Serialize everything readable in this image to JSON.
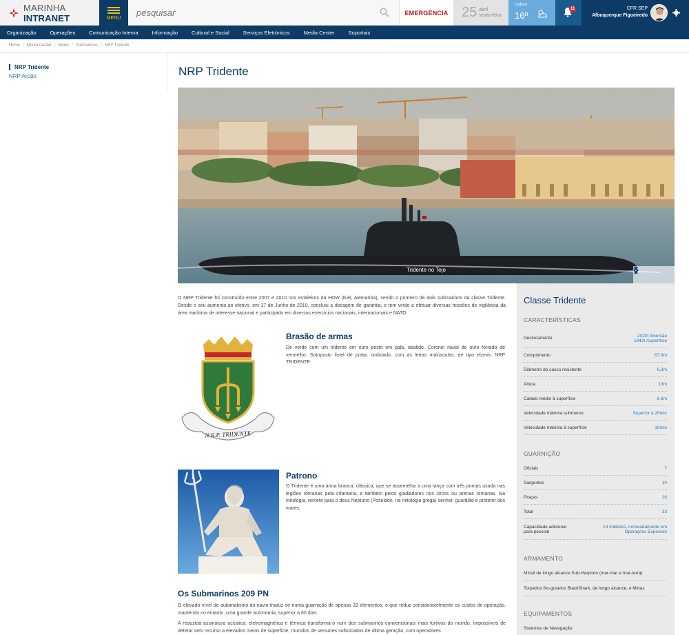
{
  "header": {
    "logo_light": "MARINHA",
    "logo_bold": "INTRANET",
    "menu_label": "MENU",
    "search_placeholder": "pesquisar",
    "emergency": "EMERGÊNCIA",
    "date_day": "25",
    "date_month": "abril",
    "date_weekday": "sexta-feira",
    "weather_city": "Lisboa",
    "weather_temp": "16º",
    "notifications_count": "11",
    "user_rank": "CFR SEP",
    "user_name": "Albuquerque Figueiredo"
  },
  "nav": [
    "Organização",
    "Operações",
    "Comunicação Interna",
    "Informação",
    "Cultural e Social",
    "Serviços Eletrónicos",
    "Media Center",
    "Suportais"
  ],
  "breadcrumb": [
    "Home",
    "Media Center",
    "Meios",
    "Submarinos",
    "NRP Tridente"
  ],
  "sidenav": {
    "active": "NRP Tridente",
    "other": "NRP Arpão"
  },
  "title": "NRP Tridente",
  "hero": {
    "caption": "Tridente no Tejo"
  },
  "intro": "O NRP Tridente foi construído entre 2007 e 2010 nos estaleiros da HDW (Kiel, Alemanha), sendo o primeiro de dois submarinos da classe Tridente. Desde o seu aumento ao efetivo, em 17 de Junho de 2010, concluiu a docagem de garantia, e tem vindo a efetuar diversas missões de vigilância da área marítima de interesse nacional e participado em diversos exercícios nacionais, internacionais e NATO.",
  "coat": {
    "title": "Brasão de armas",
    "text": "De verde com um tridente em ouro posto em pala, abatido. Coronel naval de ouro forrado de vermelho. Sotoposto listel de prata, ondulado, com as letras maiúsculas, de tipo elzevir, NRP TRIDENTE.",
    "motto": "N.R.P. TRIDENTE"
  },
  "patron": {
    "title": "Patrono",
    "text": "O Tridente é uma arma branca, clássica, que se assemelha a uma lança com três pontas usada nas legiões romanas pela infantaria, e também pelos gladiadores nos circos ou arenas romanas. Na mitologia, remete para o deus Neptuno (Poseidon, na mitologia grega) senhor, guardião e protetor dos mares."
  },
  "subs": {
    "title": "Os Submarinos 209 PN",
    "p1": "O elevado nível de automatismo do navio traduz-se numa guarnição de apenas 33 elementos, o que reduz consideravelmente os custos de operação, mantendo no entanto, uma grande autonomia, superior a 60 dias.",
    "p2": "A reduzida assinatura acústica, eletromagnética e térmica transforma-o num dos submarinos convencionais mais furtivos do mundo, impossíveis de detetar sem recurso a elevados meios de superfície, munidos de sensores sofisticados de última geração, com operadores"
  },
  "panel": {
    "title": "Classe Tridente",
    "characteristics_title": "CARACTERÍSTICAS",
    "characteristics": [
      {
        "k": "Deslocamento",
        "v1": "2020t /imersão",
        "v2": "1842t /superfície"
      },
      {
        "k": "Comprimento",
        "v1": "67,9m"
      },
      {
        "k": "Diâmetro do casco resistente",
        "v1": "6,3m"
      },
      {
        "k": "Altura",
        "v1": "13m"
      },
      {
        "k": "Calado médio à superfície",
        "v1": "6,6m"
      },
      {
        "k": "Velocidade máxima submerso",
        "v1": "Superior a 20nós"
      },
      {
        "k": "Velocidade máxima à superfície",
        "v1": "10nós"
      }
    ],
    "crew_title": "GUARNIÇÃO",
    "crew": [
      {
        "k": "Oficiais",
        "v1": "7"
      },
      {
        "k": "Sargentos",
        "v1": "10"
      },
      {
        "k": "Praças",
        "v1": "16"
      },
      {
        "k": "Total",
        "v1": "33"
      },
      {
        "k": "Capacidade adicional",
        "k2": "para pessoal",
        "v1": "14 militares, nomeadamente em",
        "v2": "Operações Especiais"
      }
    ],
    "arms_title": "ARMAMENTO",
    "arms": [
      "Míssil de longo alcance Sub-Harpoon (mar-mar e mar-terra)",
      "Torpedos filo-guiados BlackShark, de longo alcance, e Minas"
    ],
    "equip_title": "EQUIPAMENTOS",
    "equip": [
      "Sistemas de Navegação"
    ]
  }
}
